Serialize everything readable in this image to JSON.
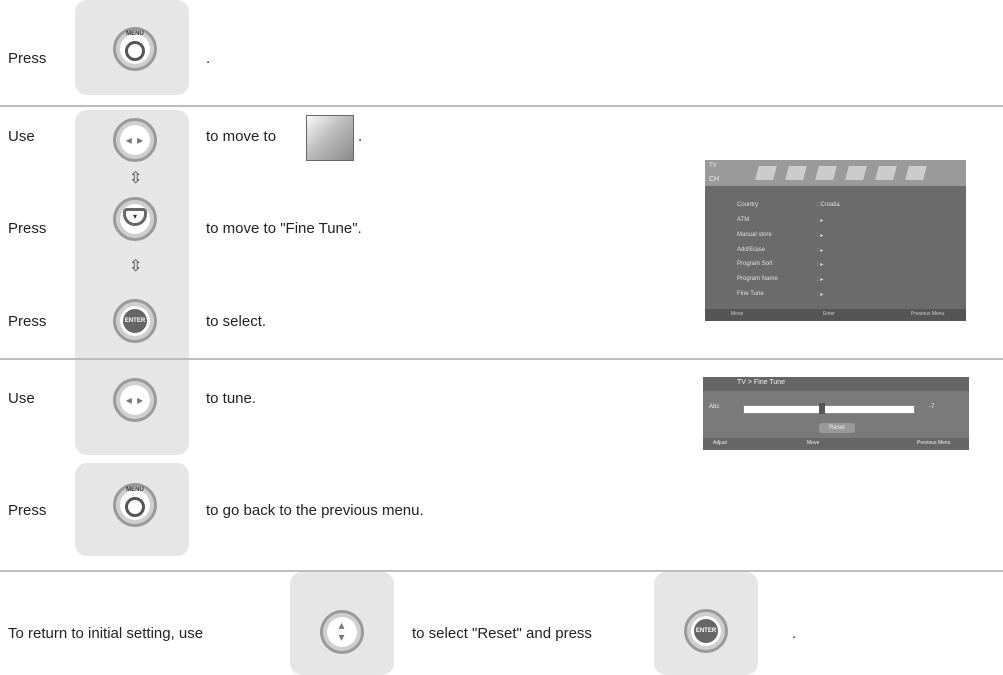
{
  "rows": {
    "row1": {
      "prefix": "Press",
      "suffix": "."
    },
    "row2": {
      "prefix": "Use",
      "suffix_before_icon": "to move to",
      "suffix_after_icon": "."
    },
    "row3": {
      "prefix": "Press",
      "suffix": "to move to \"Fine Tune\"."
    },
    "row4": {
      "prefix": "Press",
      "suffix": "to select."
    },
    "row5": {
      "prefix": "Use",
      "suffix": "to tune."
    },
    "row6": {
      "prefix": "Press",
      "suffix": "to go back to the previous menu."
    },
    "row7": {
      "prefix": "To return to initial setting, use",
      "middle": "to select \"Reset\" and press",
      "suffix": "."
    }
  },
  "buttons": {
    "menu_label": "MENU",
    "enter_label": "ENTER"
  },
  "tv_menu": {
    "title": "TV",
    "section": "CH",
    "items": [
      {
        "label": "Country",
        "value": ": Croatia"
      },
      {
        "label": "ATM",
        "value": ": ▸"
      },
      {
        "label": "Manual store",
        "value": ": ▸"
      },
      {
        "label": "Add/Erase",
        "value": ": ▸"
      },
      {
        "label": "Program Sort",
        "value": ": ▸"
      },
      {
        "label": "Program Name",
        "value": ": ▸"
      },
      {
        "label": "Fine Tune",
        "value": ": ▸"
      }
    ],
    "footer": {
      "move": "Move",
      "enter": "Enter",
      "previous": "Previous Menu"
    }
  },
  "fine_tune_screen": {
    "title": "TV > Fine Tune",
    "row_label": "Abc",
    "value": "-7",
    "reset_label": "Reset",
    "footer": {
      "adjust": "Adjust",
      "move": "Move",
      "previous": "Previous Menu"
    }
  },
  "colors": {
    "panel": "#e6e6e6",
    "divider": "#bdbdbd",
    "tv_bg": "#6b6b6b"
  }
}
